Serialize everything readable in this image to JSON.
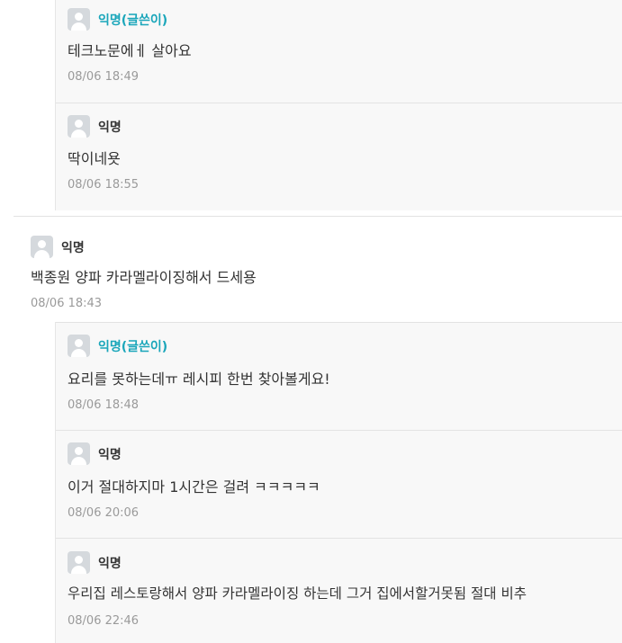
{
  "comments": [
    {
      "author": "익명(글쓴이)",
      "text": "테크노문에ㅔ 살아요",
      "date": "08/06 18:49"
    },
    {
      "author": "익명",
      "text": "딱이네욧",
      "date": "08/06 18:55"
    },
    {
      "author": "익명",
      "text": "백종원 양파 카라멜라이징해서 드세용",
      "date": "08/06 18:43"
    },
    {
      "author": "익명(글쓴이)",
      "text": "요리를 못하는데ㅠ 레시피 한번 찾아볼게요!",
      "date": "08/06 18:48"
    },
    {
      "author": "익명",
      "text": "이거 절대하지마 1시간은 걸려 ㅋㅋㅋㅋㅋ",
      "date": "08/06 20:06"
    },
    {
      "author": "익명",
      "text": "우리집 레스토랑해서 양파 카라멜라이징 하는데 그거 집에서할거못됨 절대 비추",
      "date": "08/06 22:46"
    }
  ],
  "colors": {
    "author_highlight": "#1aa6ba",
    "reply_background": "#f8f8f8",
    "date_text": "#9a9a9a"
  },
  "icons": {
    "avatar": "user-avatar-icon"
  }
}
